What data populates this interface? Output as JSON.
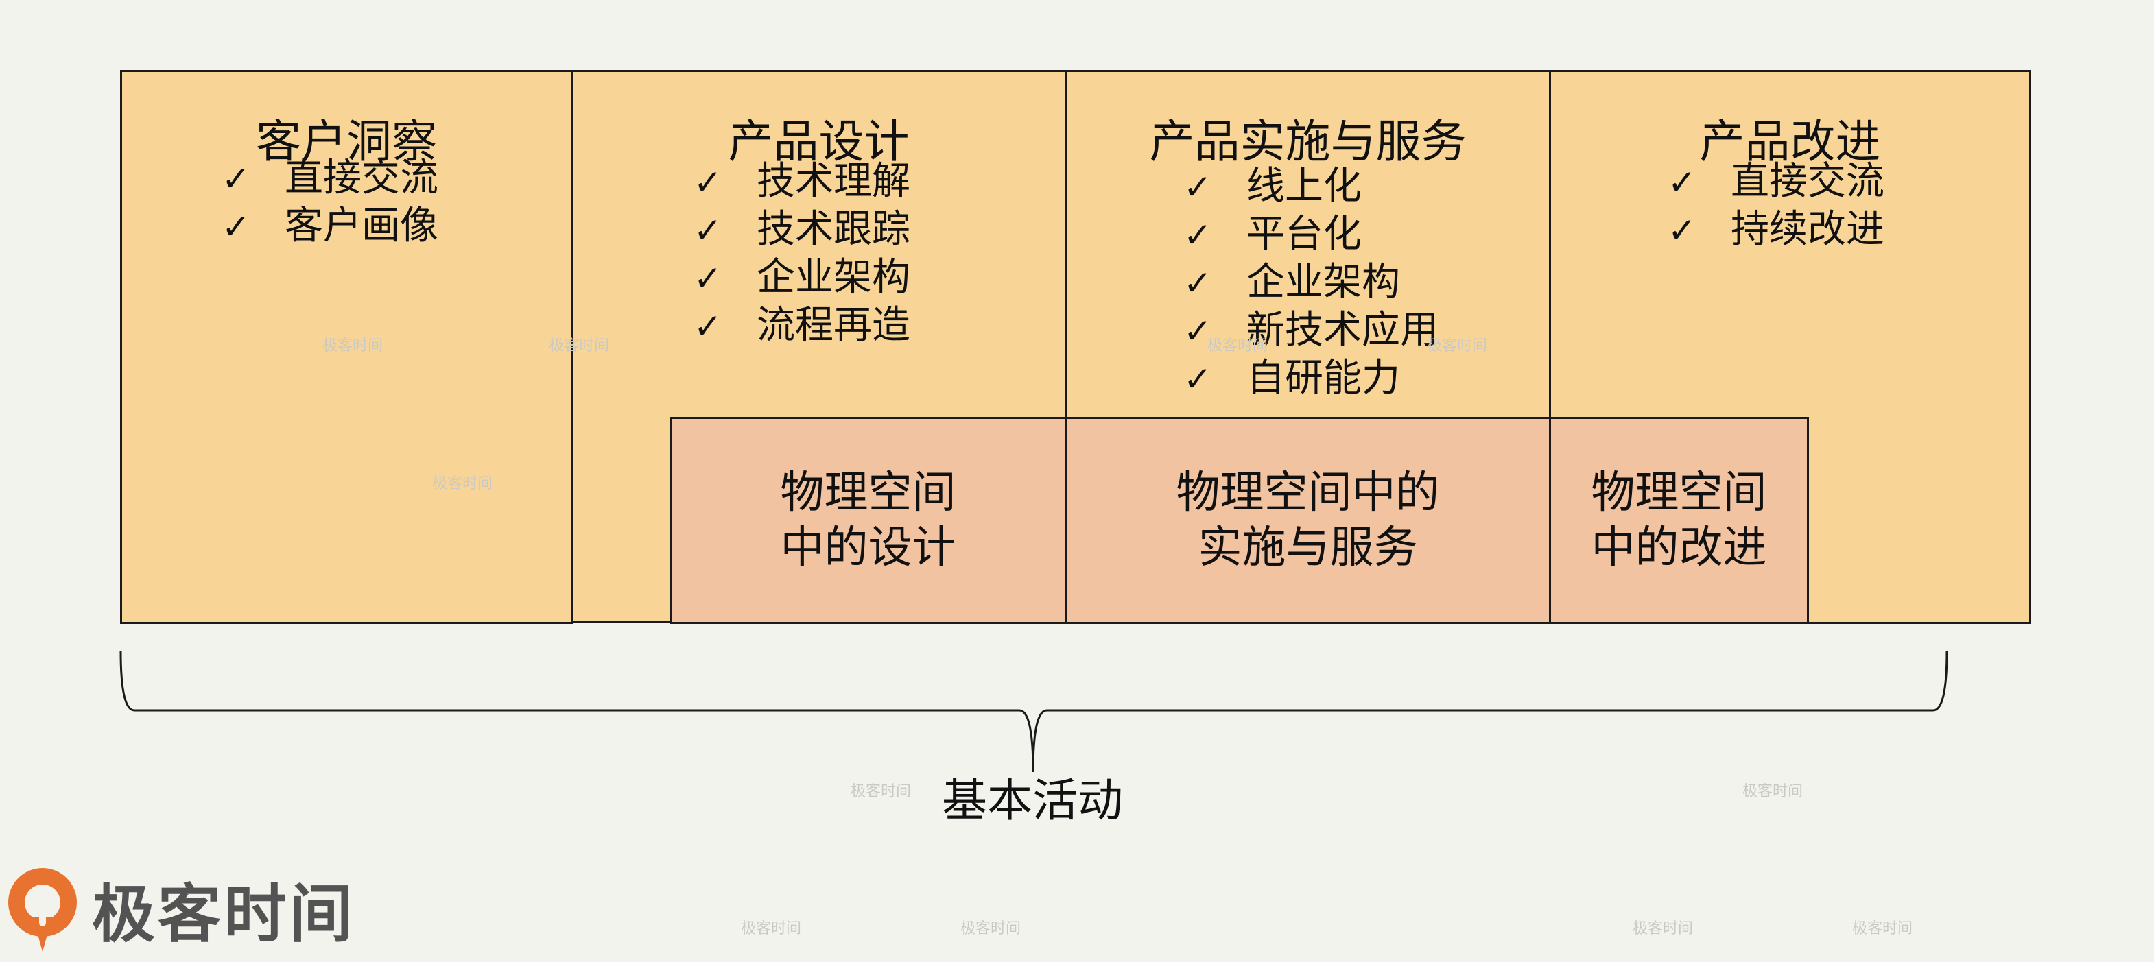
{
  "columns": [
    {
      "title": "客户洞察",
      "items": [
        "直接交流",
        "客户画像"
      ]
    },
    {
      "title": "产品设计",
      "items": [
        "技术理解",
        "技术跟踪",
        "企业架构",
        "流程再造"
      ]
    },
    {
      "title": "产品实施与服务",
      "items": [
        "线上化",
        "平台化",
        "企业架构",
        "新技术应用",
        "自研能力"
      ]
    },
    {
      "title": "产品改进",
      "items": [
        "直接交流",
        "持续改进"
      ]
    }
  ],
  "check_glyph": "✓",
  "physical_space": [
    {
      "line1": "物理空间",
      "line2": "中的设计"
    },
    {
      "line1": "物理空间中的",
      "line2": "实施与服务"
    },
    {
      "line1": "物理空间",
      "line2": "中的改进"
    }
  ],
  "brace_label": "基本活动",
  "logo": {
    "text": "极客时间",
    "icon": "geektime-logo-icon"
  },
  "watermark_text": "极客时间",
  "colors": {
    "background": "#f3f3ee",
    "box_fill": "#f8d597",
    "physical_fill": "#f2c3a1",
    "border": "#1a1a1a",
    "logo_orange": "#e8722f",
    "logo_text": "#535353"
  }
}
